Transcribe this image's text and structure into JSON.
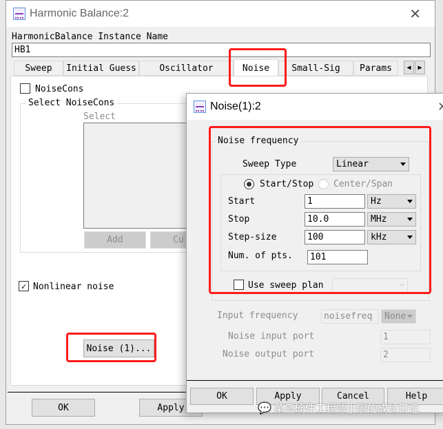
{
  "main_dialog": {
    "title": "Harmonic Balance:2",
    "instance_label": "HarmonicBalance Instance Name",
    "instance_value": "HB1",
    "tabs": [
      "Sweep",
      "Initial Guess",
      "Oscillator",
      "Noise",
      "Small-Sig",
      "Params"
    ],
    "active_tab": "Noise",
    "noisecons_label": "NoiseCons",
    "noisecons_checked": false,
    "select_group_label": "Select NoiseCons",
    "select_label": "Select",
    "add_button": "Add",
    "cut_button": "Cu",
    "nonlinear_noise_label": "Nonlinear noise",
    "nonlinear_noise_checked": true,
    "noise_button": "Noise (1)...",
    "ok_button": "OK",
    "apply_button": "Apply"
  },
  "noise_dialog": {
    "title": "Noise(1):2",
    "group_label": "Noise frequency",
    "sweep_type_label": "Sweep Type",
    "sweep_type_value": "Linear",
    "radio_start_stop": "Start/Stop",
    "radio_center_span": "Center/Span",
    "selected_radio": "Start/Stop",
    "rows": [
      {
        "label": "Start",
        "value": "1",
        "unit": "Hz"
      },
      {
        "label": "Stop",
        "value": "10.0",
        "unit": "MHz"
      },
      {
        "label": "Step-size",
        "value": "100",
        "unit": "kHz"
      }
    ],
    "num_pts_label": "Num. of pts.",
    "num_pts_value": "101",
    "use_sweep_plan_label": "Use sweep plan",
    "use_sweep_plan_checked": false,
    "input_frequency_label": "Input frequency",
    "input_frequency_value": "noisefreq",
    "input_frequency_unit": "None",
    "noise_input_port_label": "Noise input port",
    "noise_input_port_value": "1",
    "noise_output_port_label": "Noise output port",
    "noise_output_port_value": "2",
    "buttons": [
      "OK",
      "Apply",
      "Cancel",
      "Help"
    ]
  },
  "watermark": "菜鸟硬件工程师小廖的成长日记",
  "colors": {
    "highlight": "#ff1a1a",
    "dialog_bg": "#f0f0f0"
  }
}
